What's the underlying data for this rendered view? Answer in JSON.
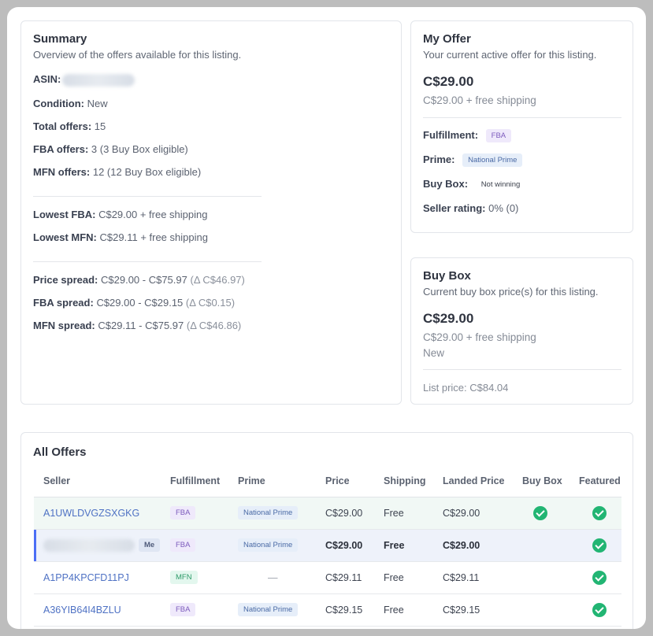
{
  "summary": {
    "title": "Summary",
    "subtitle": "Overview of the offers available for this listing.",
    "asin_label": "ASIN:",
    "condition_label": "Condition:",
    "condition_value": "New",
    "total_label": "Total offers:",
    "total_value": "15",
    "fba_label": "FBA offers:",
    "fba_value": "3 (3 Buy Box eligible)",
    "mfn_label": "MFN offers:",
    "mfn_value": "12 (12 Buy Box eligible)",
    "lowest_fba_label": "Lowest FBA:",
    "lowest_fba_value": "C$29.00 + free shipping",
    "lowest_mfn_label": "Lowest MFN:",
    "lowest_mfn_value": "C$29.11 + free shipping",
    "price_spread_label": "Price spread:",
    "price_spread_value": "C$29.00 - C$75.97",
    "price_spread_delta": "(Δ C$46.97)",
    "fba_spread_label": "FBA spread:",
    "fba_spread_value": "C$29.00 - C$29.15",
    "fba_spread_delta": "(Δ C$0.15)",
    "mfn_spread_label": "MFN spread:",
    "mfn_spread_value": "C$29.11 - C$75.97",
    "mfn_spread_delta": "(Δ C$46.86)"
  },
  "my_offer": {
    "title": "My Offer",
    "subtitle": "Your current active offer for this listing.",
    "price": "C$29.00",
    "price_detail": "C$29.00 + free shipping",
    "fulfillment_label": "Fulfillment:",
    "fulfillment_value": "FBA",
    "prime_label": "Prime:",
    "prime_value": "National Prime",
    "buybox_label": "Buy Box:",
    "buybox_value": "Not winning",
    "rating_label": "Seller rating:",
    "rating_value": "0% (0)"
  },
  "buy_box": {
    "title": "Buy Box",
    "subtitle": "Current buy box price(s) for this listing.",
    "price": "C$29.00",
    "price_detail": "C$29.00 + free shipping",
    "condition": "New",
    "list_price": "List price: C$84.04"
  },
  "all_offers": {
    "title": "All Offers",
    "columns": [
      "Seller",
      "Fulfillment",
      "Prime",
      "Price",
      "Shipping",
      "Landed Price",
      "Buy Box",
      "Featured"
    ],
    "me_label": "Me",
    "rows": [
      {
        "seller": "A1UWLDVGZSXGKG",
        "fulfillment": "FBA",
        "prime": "National Prime",
        "price": "C$29.00",
        "shipping": "Free",
        "landed": "C$29.00",
        "buybox": true,
        "featured": true,
        "is_me": false
      },
      {
        "seller": "",
        "fulfillment": "FBA",
        "prime": "National Prime",
        "price": "C$29.00",
        "shipping": "Free",
        "landed": "C$29.00",
        "buybox": false,
        "featured": true,
        "is_me": true
      },
      {
        "seller": "A1PP4KPCFD11PJ",
        "fulfillment": "MFN",
        "prime": "—",
        "price": "C$29.11",
        "shipping": "Free",
        "landed": "C$29.11",
        "buybox": false,
        "featured": true,
        "is_me": false
      },
      {
        "seller": "A36YIB64I4BZLU",
        "fulfillment": "FBA",
        "prime": "National Prime",
        "price": "C$29.15",
        "shipping": "Free",
        "landed": "C$29.15",
        "buybox": false,
        "featured": true,
        "is_me": false
      }
    ]
  },
  "colors": {
    "check_green": "#22b573",
    "link_blue": "#4f72c4",
    "me_accent": "#4c6ef5"
  }
}
